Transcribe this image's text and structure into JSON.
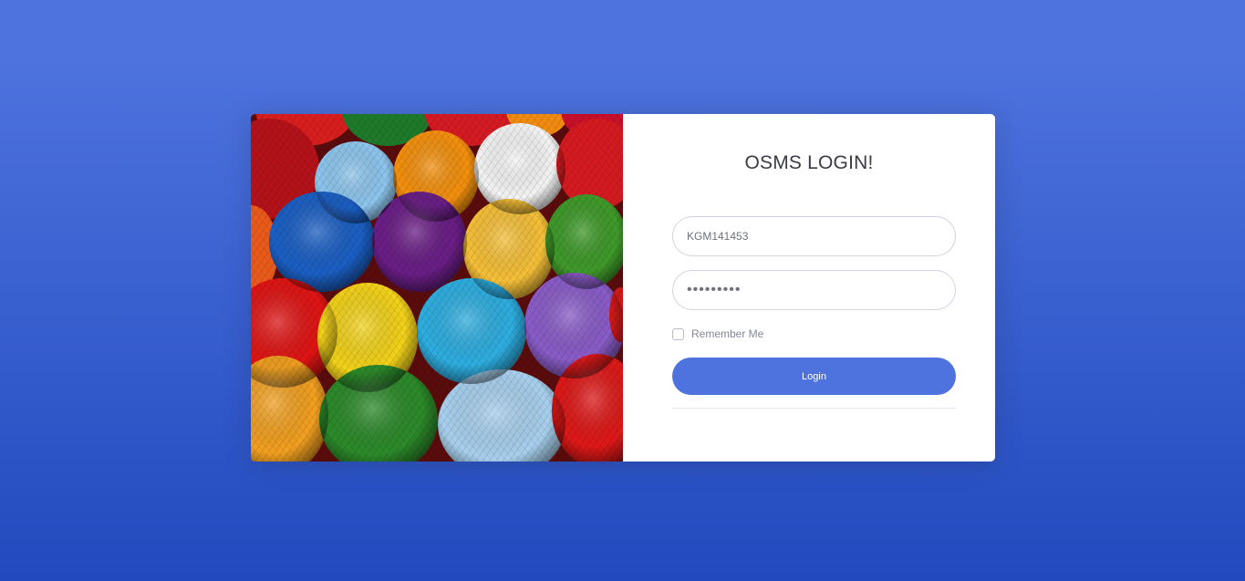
{
  "login": {
    "title": "OSMS LOGIN!",
    "username_value": "KGM141453",
    "password_masked": "•••••••••",
    "remember_label": "Remember Me",
    "remember_checked": false,
    "login_label": "Login"
  },
  "colors": {
    "background_top": "#4e73df",
    "background_bottom": "#224abe",
    "button": "#4e73df"
  },
  "image": {
    "subject": "colorful-yarn-balls"
  }
}
